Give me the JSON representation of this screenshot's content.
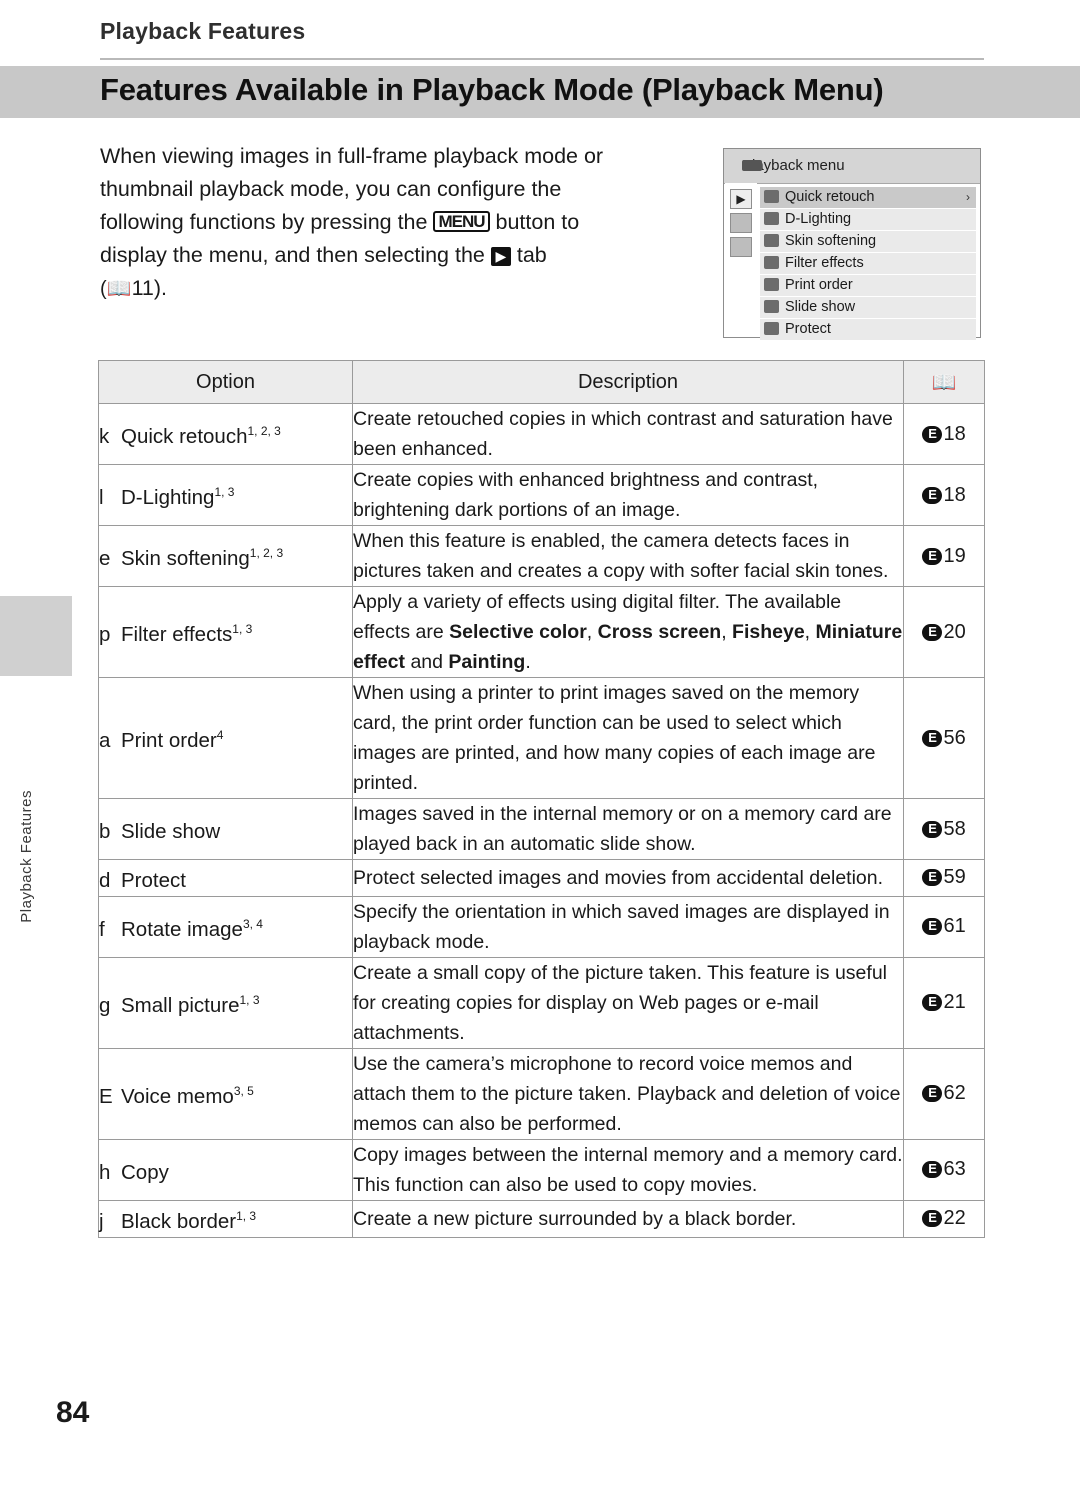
{
  "header": {
    "running_head": "Playback Features",
    "title": "Features Available in Playback Mode (Playback Menu)"
  },
  "intro": {
    "line1": "When viewing images in full-frame playback mode or",
    "line2": "thumbnail playback mode, you can configure the",
    "line3a": "following functions by pressing the",
    "menu_button": "MENU",
    "line3b": "button to",
    "line4a": "display the menu, and then selecting the",
    "play_tab": "▶",
    "line4b": "tab",
    "line5": "11)."
  },
  "camera_screen": {
    "title": "Playback menu",
    "battery_icon": "battery-icon",
    "tabs": [
      "playback-tab",
      "movie-tab",
      "setup-tab"
    ],
    "items": [
      {
        "label": "Quick retouch",
        "selected": true,
        "arrow": "›"
      },
      {
        "label": "D-Lighting",
        "selected": false
      },
      {
        "label": "Skin softening",
        "selected": false
      },
      {
        "label": "Filter effects",
        "selected": false
      },
      {
        "label": "Print order",
        "selected": false
      },
      {
        "label": "Slide show",
        "selected": false
      },
      {
        "label": "Protect",
        "selected": false
      }
    ]
  },
  "side_label": "Playback Features",
  "table": {
    "headers": {
      "option": "Option",
      "description": "Description",
      "reference": "book-icon"
    },
    "rows": [
      {
        "symbol": "k",
        "name": "Quick retouch",
        "sup": "1, 2, 3",
        "desc": "Create retouched copies in which contrast and saturation have been enhanced.",
        "ref": "18"
      },
      {
        "symbol": "l",
        "name": "D-Lighting",
        "sup": "1, 3",
        "desc": "Create copies with enhanced brightness and contrast, brightening dark portions of an image.",
        "ref": "18"
      },
      {
        "symbol": "e",
        "name": "Skin softening",
        "sup": "1, 2, 3",
        "desc": "When this feature is enabled, the camera detects faces in pictures taken and creates a copy with softer facial skin tones.",
        "ref": "19"
      },
      {
        "symbol": "p",
        "name": "Filter effects",
        "sup": "1, 3",
        "desc_part1": "Apply a variety of effects using digital filter. The available effects are ",
        "desc_bold1": "Selective color",
        "desc_sep1": ", ",
        "desc_bold2": "Cross screen",
        "desc_sep2": ", ",
        "desc_bold3": "Fisheye",
        "desc_sep3": ", ",
        "desc_bold4": "Miniature effect",
        "desc_mid": " and ",
        "desc_bold5": "Painting",
        "desc_end": ".",
        "ref": "20"
      },
      {
        "symbol": "a",
        "name": "Print order",
        "sup": "4",
        "desc": "When using a printer to print images saved on the memory card, the print order function can be used to select which images are printed, and how many copies of each image are printed.",
        "ref": "56"
      },
      {
        "symbol": "b",
        "name": "Slide show",
        "sup": "",
        "desc": "Images saved in the internal memory or on a memory card are played back in an automatic slide show.",
        "ref": "58"
      },
      {
        "symbol": "d",
        "name": "Protect",
        "sup": "",
        "desc": "Protect selected images and movies from accidental deletion.",
        "ref": "59"
      },
      {
        "symbol": "f",
        "name": "Rotate image",
        "sup": "3, 4",
        "desc": "Specify the orientation in which saved images are displayed in playback mode.",
        "ref": "61"
      },
      {
        "symbol": "g",
        "name": "Small picture",
        "sup": "1, 3",
        "desc": "Create a small copy of the picture taken. This feature is useful for creating copies for display on Web pages or e-mail attachments.",
        "ref": "21"
      },
      {
        "symbol": "E",
        "name": "Voice memo",
        "sup": "3, 5",
        "desc": "Use the camera’s microphone to record voice memos and attach them to the picture taken. Playback and deletion of voice memos can also be performed.",
        "ref": "62"
      },
      {
        "symbol": "h",
        "name": "Copy",
        "sup": "",
        "desc": "Copy images between the internal memory and a memory card. This function can also be used to copy movies.",
        "ref": "63"
      },
      {
        "symbol": "j",
        "name": "Black border",
        "sup": "1, 3",
        "desc": "Create a new picture surrounded by a black border.",
        "ref": "22"
      }
    ]
  },
  "footer": {
    "page_number": "84"
  }
}
